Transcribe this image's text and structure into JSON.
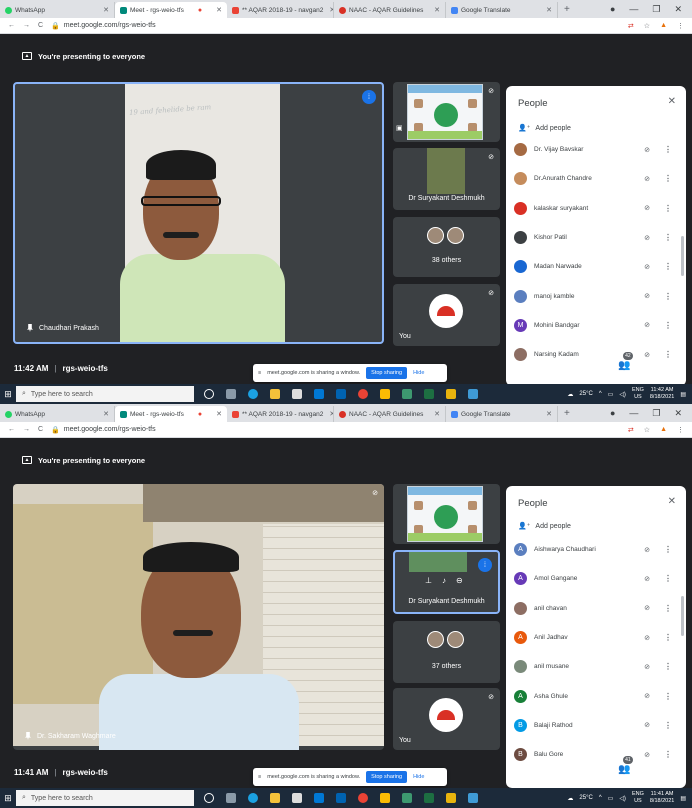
{
  "screens": [
    {
      "tabs": [
        {
          "label": "WhatsApp",
          "color": "#25d366"
        },
        {
          "label": "Meet - rgs-weio-tfs",
          "color": "#00897b"
        },
        {
          "label": "** AQAR 2018-19 - navgan2",
          "color": "#ea4335"
        },
        {
          "label": "NAAC - AQAR Guidelines",
          "color": "#d93025"
        },
        {
          "label": "Google Translate",
          "color": "#4285f4"
        }
      ],
      "url": "meet.google.com/rgs-weio-tfs",
      "presenting_text": "You're presenting to everyone",
      "main_speaker": "Chaudhari Prakash",
      "board_text": "19 and fehelide be ram",
      "side_tile_name": "Dr Suryakant Deshmukh",
      "others_label": "38 others",
      "you_label": "You",
      "time": "11:42 AM",
      "meeting_code": "rgs-weio-tfs",
      "participant_count": "42",
      "share_text": "meet.google.com is sharing a window.",
      "stop_sharing": "Stop sharing",
      "hide": "Hide",
      "people_title": "People",
      "add_people": "Add people",
      "participants": [
        {
          "name": "Dr. Vijay Bavskar",
          "color": "#a56a43"
        },
        {
          "name": "Dr.Anurath Chandre",
          "color": "#c58c5c"
        },
        {
          "name": "kalaskar suryakant",
          "color": "#d93025"
        },
        {
          "name": "Kishor Patil",
          "color": "#3c4043"
        },
        {
          "name": "Madan Narwade",
          "color": "#1967d2"
        },
        {
          "name": "manoj kamble",
          "color": "#5b7fbf"
        },
        {
          "name": "Mohini Bandgar",
          "color": "#673ab7",
          "initial": "M"
        },
        {
          "name": "Narsing Kadam",
          "color": "#8d6e63"
        }
      ],
      "taskbar_search": "Type here to search",
      "weather": "25°C",
      "lang": "ENG",
      "region": "US",
      "clock_time": "11:42 AM",
      "clock_date": "8/18/2021"
    },
    {
      "tabs": [
        {
          "label": "WhatsApp",
          "color": "#25d366"
        },
        {
          "label": "Meet - rgs-weio-tfs",
          "color": "#00897b"
        },
        {
          "label": "** AQAR 2018-19 - navgan2",
          "color": "#ea4335"
        },
        {
          "label": "NAAC - AQAR Guidelines",
          "color": "#d93025"
        },
        {
          "label": "Google Translate",
          "color": "#4285f4"
        }
      ],
      "url": "meet.google.com/rgs-weio-tfs",
      "presenting_text": "You're presenting to everyone",
      "main_speaker": "Dr. Sakharam Waghmare",
      "side_tile_name": "Dr Suryakant Deshmukh",
      "others_label": "37 others",
      "you_label": "You",
      "time": "11:41 AM",
      "meeting_code": "rgs-weio-tfs",
      "participant_count": "41",
      "share_text": "meet.google.com is sharing a window.",
      "stop_sharing": "Stop sharing",
      "hide": "Hide",
      "people_title": "People",
      "add_people": "Add people",
      "participants": [
        {
          "name": "Aishwarya Chaudhari",
          "color": "#5b7fbf",
          "initial": "A"
        },
        {
          "name": "Amol Gangane",
          "color": "#673ab7",
          "initial": "A"
        },
        {
          "name": "anil chavan",
          "color": "#8d6e63"
        },
        {
          "name": "Anil Jadhav",
          "color": "#e8590c",
          "initial": "A"
        },
        {
          "name": "anil musane",
          "color": "#7a8a7a"
        },
        {
          "name": "Asha Ghule",
          "color": "#188038",
          "initial": "A"
        },
        {
          "name": "Balaji Rathod",
          "color": "#039be5",
          "initial": "B"
        },
        {
          "name": "Balu Gore",
          "color": "#6d4c41",
          "initial": "B"
        }
      ],
      "taskbar_search": "Type here to search",
      "weather": "25°C",
      "lang": "ENG",
      "region": "US",
      "clock_time": "11:41 AM",
      "clock_date": "8/18/2021"
    }
  ]
}
